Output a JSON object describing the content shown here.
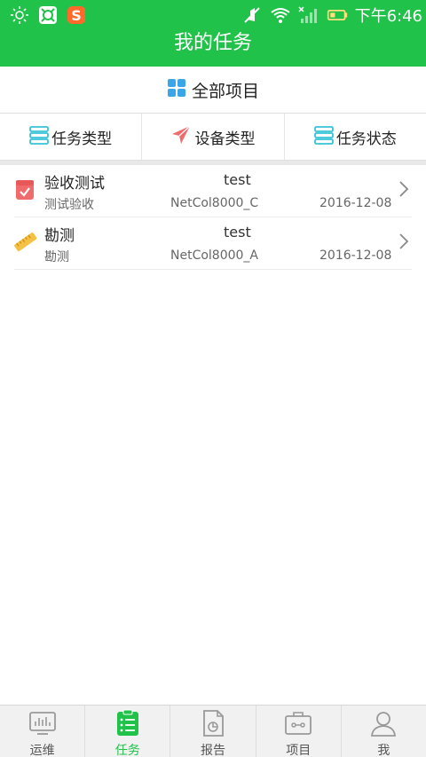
{
  "status_bar": {
    "time": "下午6:46"
  },
  "header": {
    "title": "我的任务"
  },
  "all_projects": {
    "label": "全部项目"
  },
  "filters": [
    {
      "label": "任务类型",
      "icon": "list-icon"
    },
    {
      "label": "设备类型",
      "icon": "send-icon"
    },
    {
      "label": "任务状态",
      "icon": "list-icon"
    }
  ],
  "tasks": [
    {
      "name": "验收测试",
      "sub": "测试验收",
      "project": "test",
      "device": "NetCol8000_C",
      "date": "2016-12-08"
    },
    {
      "name": "勘测",
      "sub": "勘测",
      "project": "test",
      "device": "NetCol8000_A",
      "date": "2016-12-08"
    }
  ],
  "nav": [
    {
      "label": "运维",
      "icon": "monitor-icon"
    },
    {
      "label": "任务",
      "icon": "task-icon",
      "active": true
    },
    {
      "label": "报告",
      "icon": "report-icon"
    },
    {
      "label": "项目",
      "icon": "project-icon"
    },
    {
      "label": "我",
      "icon": "user-icon"
    }
  ],
  "colors": {
    "primary": "#21c249",
    "accent_blue": "#3aa6e8",
    "accent_red": "#f06b6b",
    "icon_cyan": "#35c2d8"
  }
}
